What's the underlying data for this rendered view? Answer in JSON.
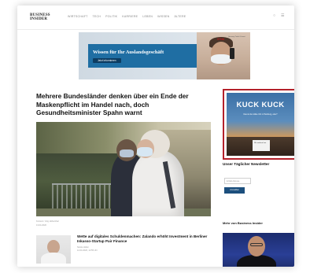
{
  "header": {
    "logo_line1": "BUSINESS",
    "logo_line2": "INSIDER",
    "nav": [
      "Wirtschaft",
      "Tech",
      "Politik",
      "Karriere",
      "Leben",
      "Wissen",
      "Ältere"
    ]
  },
  "banner_ad": {
    "title": "Wissen für Ihr Auslandsgeschäft",
    "button": "Jetzt informieren",
    "brand": "GTAI",
    "brand_sub": "Germany Trade & Invest"
  },
  "article": {
    "headline": "Mehrere Bundesländer denken über ein Ende der Maskenpflicht im Handel nach, doch Gesundheitsminister Spahn warnt",
    "caption": "Kontext / Jörg Hübenthal",
    "date": "13.04.2020"
  },
  "related": {
    "title": "Wette auf digitales Schuldenmachen: Zalando erhöht Investment in Berliner Inkasso-Startup Pair Finance",
    "author": "Nicole Hüller",
    "date": "12.04.2020, 12:55 Uhr"
  },
  "side_ad": {
    "headline": "KUCK KUCK",
    "sub": "Das ist die tollste Uhr in Hamburg, oder?",
    "box_text": "Wir werben hier"
  },
  "newsletter": {
    "title": "Unser Täglicher Newsletter",
    "input_placeholder": "E-Mail-Adresse",
    "button": "Anmelden"
  },
  "more": {
    "title": "Mehr von Business Insider"
  }
}
